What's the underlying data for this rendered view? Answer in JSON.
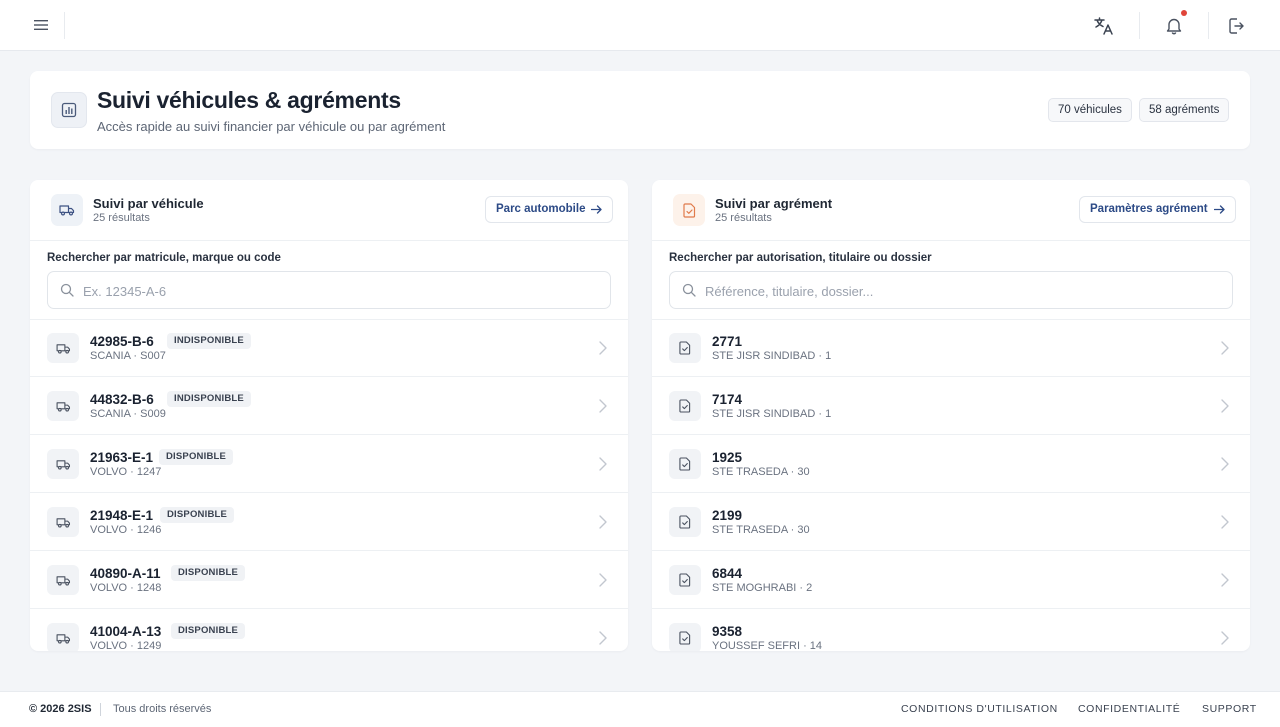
{
  "topbar": {
    "icons": [
      "menu-icon",
      "translate-icon",
      "bell-icon",
      "logout-icon"
    ],
    "notification_dot_color": "#e0453a"
  },
  "header": {
    "title": "Suivi véhicules & agréments",
    "subtitle": "Accès rapide au suivi financier par véhicule ou par agrément",
    "vehicles_pill": "70 véhicules",
    "agreements_pill": "58 agréments",
    "icon": "chart-icon"
  },
  "vehicles_panel": {
    "title": "Suivi par véhicule",
    "count": "25 résultats",
    "link_label": "Parc automobile",
    "search_label": "Rechercher par matricule, marque ou code",
    "search_placeholder": "Ex. 12345-A-6",
    "search_value": "",
    "rows": [
      {
        "plate": "42985-B-6",
        "status": "INDISPONIBLE",
        "detail": "SCANIA · S007"
      },
      {
        "plate": "44832-B-6",
        "status": "INDISPONIBLE",
        "detail": "SCANIA · S009"
      },
      {
        "plate": "21963-E-1",
        "status": "DISPONIBLE",
        "detail": "VOLVO · 1247"
      },
      {
        "plate": "21948-E-1",
        "status": "DISPONIBLE",
        "detail": "VOLVO · 1246"
      },
      {
        "plate": "40890-A-11",
        "status": "DISPONIBLE",
        "detail": "VOLVO · 1248"
      },
      {
        "plate": "41004-A-13",
        "status": "DISPONIBLE",
        "detail": "VOLVO · 1249"
      }
    ]
  },
  "agreements_panel": {
    "title": "Suivi par agrément",
    "count": "25 résultats",
    "link_label": "Paramètres agrément",
    "search_label": "Rechercher par autorisation, titulaire ou dossier",
    "search_placeholder": "Référence, titulaire, dossier...",
    "search_value": "",
    "rows": [
      {
        "ref": "2771",
        "detail": "STE JISR SINDIBAD · 1"
      },
      {
        "ref": "7174",
        "detail": "STE JISR SINDIBAD · 1"
      },
      {
        "ref": "1925",
        "detail": "STE TRASEDA · 30"
      },
      {
        "ref": "2199",
        "detail": "STE TRASEDA · 30"
      },
      {
        "ref": "6844",
        "detail": "STE MOGHRABI · 2"
      },
      {
        "ref": "9358",
        "detail": "YOUSSEF SEFRI · 14"
      }
    ]
  },
  "footer": {
    "copyright": "© 2026 2SIS",
    "rights": "Tous droits réservés",
    "links": [
      "CONDITIONS D'UTILISATION",
      "CONFIDENTIALITÉ",
      "SUPPORT"
    ]
  },
  "colors": {
    "background": "#f3f5f8",
    "accent": "#2c4a86",
    "agreement_icon": "#e07a4a"
  }
}
